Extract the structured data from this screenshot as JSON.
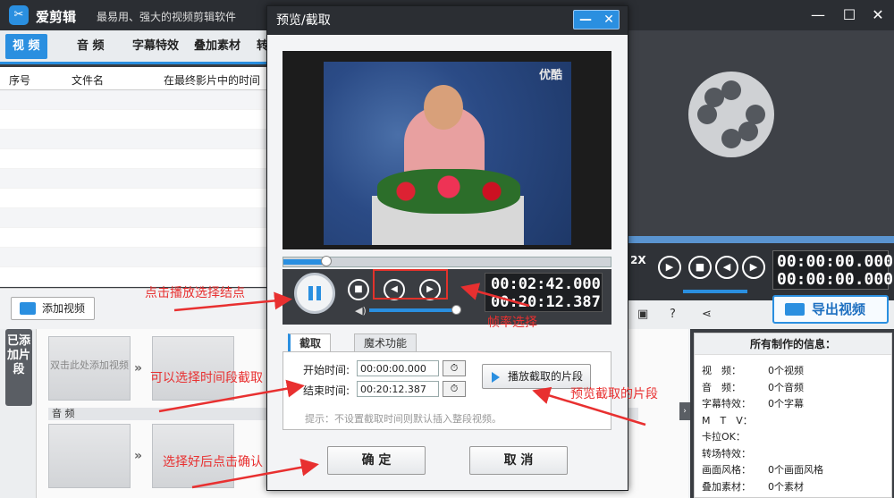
{
  "app": {
    "logo_glyph": "✂",
    "name": "爱剪辑",
    "slogan": "最易用、强大的视频剪辑软件"
  },
  "window_controls": {
    "minimize": "—",
    "maximize": "☐",
    "close": "✕"
  },
  "tabs": [
    {
      "label": "视 频"
    },
    {
      "label": "音 频"
    },
    {
      "label": "字幕特效"
    },
    {
      "label": "叠加素材"
    },
    {
      "label": "转"
    }
  ],
  "table": {
    "col_index": "序号",
    "col_name": "文件名",
    "col_time": "在最终影片中的时间"
  },
  "add_video_label": "添加视频",
  "side_tab_label": "已添加片段",
  "timeline": {
    "placeholder": "双击此处添加视频",
    "audio_label": "音 频"
  },
  "right": {
    "speed": "2X",
    "time_current": "00:00:00.000",
    "time_total": "00:00:00.000",
    "export_label": "导出视频"
  },
  "info": {
    "title": "所有制作的信息：",
    "rows": [
      {
        "k": "视　频：",
        "v": "0个视频"
      },
      {
        "k": "音　频：",
        "v": "0个音频"
      },
      {
        "k": "字幕特效：",
        "v": "0个字幕"
      },
      {
        "k": "M　T　V：",
        "v": ""
      },
      {
        "k": "卡拉OK：",
        "v": ""
      },
      {
        "k": "转场特效：",
        "v": ""
      },
      {
        "k": "画面风格：",
        "v": "0个画面风格"
      },
      {
        "k": "叠加素材：",
        "v": "0个素材"
      }
    ]
  },
  "dialog": {
    "title": "预览/截取",
    "minimize": "—",
    "close": "✕",
    "watermark": "优酷",
    "progress_pct": 13,
    "time_current": "00:02:42.000",
    "time_total": "00:20:12.387",
    "volume_pct": 92,
    "tabs": [
      {
        "label": "截取"
      },
      {
        "label": "魔术功能"
      }
    ],
    "start_label": "开始时间:",
    "start_value": "00:00:00.000",
    "end_label": "结束时间:",
    "end_value": "00:20:12.387",
    "preview_button": "播放截取的片段",
    "hint": "提示：不设置截取时间则默认插入整段视频。",
    "ok": "确 定",
    "cancel": "取 消"
  },
  "annotations": {
    "play_point": "点击播放选择结点",
    "frame_select": "帧率选择",
    "time_range": "可以选择时间段截取",
    "preview_clip": "预览截取的片段",
    "confirm": "选择好后点击确认"
  },
  "colors": {
    "accent": "#2a8fe0",
    "annotation": "#e83030",
    "titlebar": "#2b2e33"
  }
}
